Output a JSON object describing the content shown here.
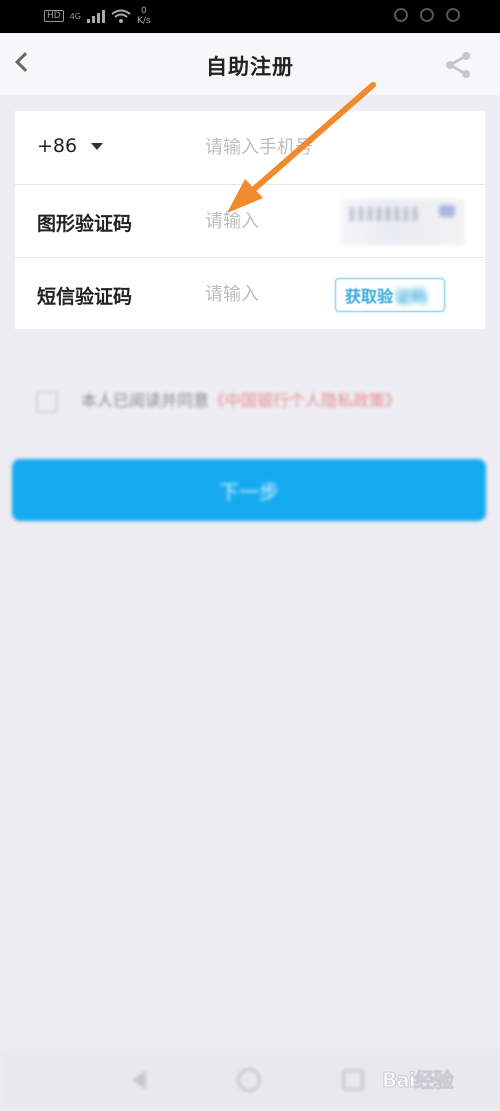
{
  "status_bar": {
    "network_badge": "HD",
    "network_type": "4G",
    "speed_value": "0",
    "speed_unit": "K/s"
  },
  "header": {
    "title": "自助注册",
    "back_icon": "chevron-left-icon",
    "share_icon": "share-icon"
  },
  "form": {
    "phone": {
      "country_code": "+86",
      "placeholder": "请输入手机号"
    },
    "captcha": {
      "label": "图形验证码",
      "placeholder": "请输入"
    },
    "sms": {
      "label": "短信验证码",
      "placeholder": "请输入",
      "button_label": "获取验",
      "button_label_blurred": "证码"
    }
  },
  "agreement": {
    "text": "本人已阅读并同意",
    "link_text": "《中国银行个人隐私政策》"
  },
  "next_button": {
    "label": "下一步"
  },
  "watermark": {
    "text": "Bai经验"
  },
  "colors": {
    "accent": "#15aaf0",
    "annotation_arrow": "#f08a2c",
    "page_background": "#eeedf3"
  }
}
